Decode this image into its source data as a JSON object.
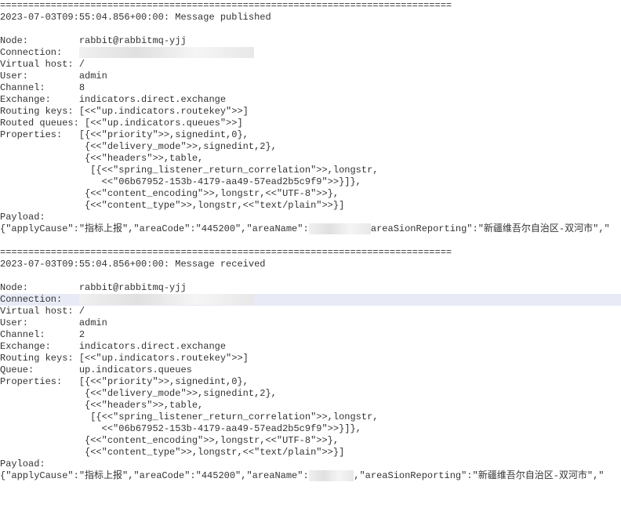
{
  "sep": "================================================================================",
  "msg1": {
    "ts": "2023-07-03T09:55:04.856+00:00",
    "title": "Message published",
    "node_lbl": "Node:",
    "node_val_pre": "rabbit@rabbitmq-yjj",
    "conn_lbl": "Connection:",
    "conn_blur": "                               ",
    "vhost_lbl": "Virtual host:",
    "vhost_val": "/",
    "user_lbl": "User:",
    "user_val": "admin",
    "chan_lbl": "Channel:",
    "chan_val": "8",
    "exch_lbl": "Exchange:",
    "exch_val": "indicators.direct.exchange",
    "rk_lbl": "Routing keys:",
    "rk_val": "[<<\"up.indicators.routekey\">>]",
    "rq_lbl": "Routed queues:",
    "rq_val": "[<<\"up.indicators.queues\">>]",
    "prop_lbl": "Properties:",
    "prop_l1": "[{<<\"priority\">>,signedint,0},",
    "prop_l2": " {<<\"delivery_mode\">>,signedint,2},",
    "prop_l3": " {<<\"headers\">>,table,",
    "prop_l4": "  [{<<\"spring_listener_return_correlation\">>,longstr,",
    "prop_l5": "    <<\"06b67952-153b-4179-aa49-57ead2b5c9f9\">>}]},",
    "prop_l6": " {<<\"content_encoding\">>,longstr,<<\"UTF-8\">>},",
    "prop_l7": " {<<\"content_type\">>,longstr,<<\"text/plain\">>}]",
    "pl_lbl": "Payload:",
    "pl_pre": "{\"applyCause\":\"指标上报\",\"areaCode\":\"445200\",\"areaName\":",
    "pl_blur": "           ",
    "pl_post": "areaSionReporting\":\"新疆维吾尔自治区-双河市\",\""
  },
  "msg2": {
    "ts": "2023-07-03T09:55:04.856+00:00",
    "title": "Message received",
    "node_lbl": "Node:",
    "node_val": "rabbit@rabbitmq-yjj",
    "conn_lbl": "Connection:",
    "conn_blur": "                               ",
    "vhost_lbl": "Virtual host:",
    "vhost_val": "/",
    "user_lbl": "User:",
    "user_val": "admin",
    "chan_lbl": "Channel:",
    "chan_val": "2",
    "exch_lbl": "Exchange:",
    "exch_val": "indicators.direct.exchange",
    "rk_lbl": "Routing keys:",
    "rk_val": "[<<\"up.indicators.routekey\">>]",
    "q_lbl": "Queue:",
    "q_val": "up.indicators.queues",
    "prop_lbl": "Properties:",
    "prop_l1": "[{<<\"priority\">>,signedint,0},",
    "prop_l2": " {<<\"delivery_mode\">>,signedint,2},",
    "prop_l3": " {<<\"headers\">>,table,",
    "prop_l4": "  [{<<\"spring_listener_return_correlation\">>,longstr,",
    "prop_l5": "    <<\"06b67952-153b-4179-aa49-57ead2b5c9f9\">>}]},",
    "prop_l6": " {<<\"content_encoding\">>,longstr,<<\"UTF-8\">>},",
    "prop_l7": " {<<\"content_type\">>,longstr,<<\"text/plain\">>}]",
    "pl_lbl": "Payload:",
    "pl_pre": "{\"applyCause\":\"指标上报\",\"areaCode\":\"445200\",\"areaName\":",
    "pl_blur": "        ",
    "pl_post": ",\"areaSionReporting\":\"新疆维吾尔自治区-双河市\",\""
  }
}
